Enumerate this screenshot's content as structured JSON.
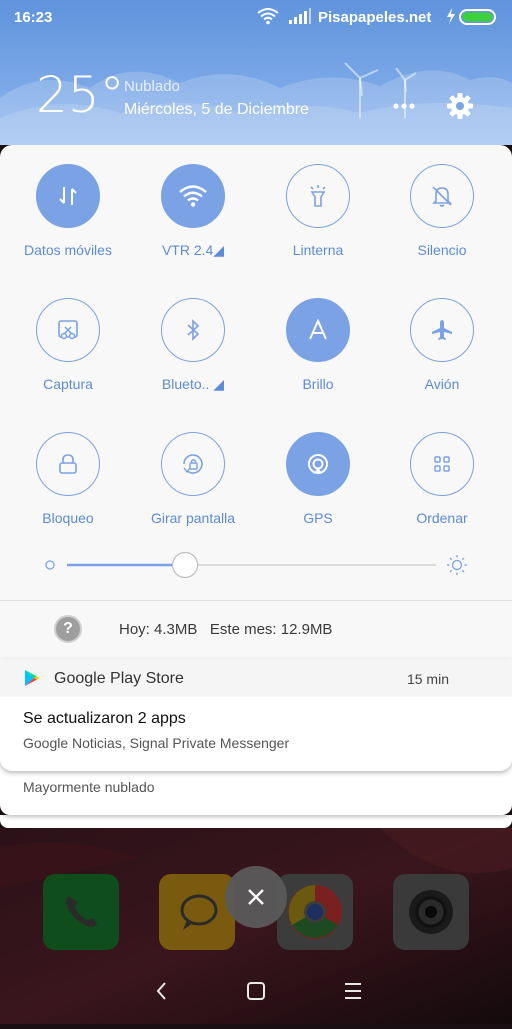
{
  "status_bar": {
    "time": "16:23",
    "carrier": "Pisapapeles.net",
    "icons": [
      "wifi-icon",
      "signal-icon",
      "charging-icon",
      "battery-icon"
    ],
    "battery_color": "#3cd03c"
  },
  "weather": {
    "temperature": "25°",
    "condition": "Nublado",
    "date": "Miércoles, 5 de Diciembre"
  },
  "quick_settings": {
    "accent_color": "#7ba2e5",
    "tiles": [
      {
        "label": "Datos móviles",
        "icon": "mobile-data-icon",
        "active": true
      },
      {
        "label": "VTR 2.4◢",
        "icon": "wifi-icon",
        "active": true
      },
      {
        "label": "Linterna",
        "icon": "flashlight-icon",
        "active": false
      },
      {
        "label": "Silencio",
        "icon": "bell-off-icon",
        "active": false
      },
      {
        "label": "Captura",
        "icon": "screenshot-icon",
        "active": false
      },
      {
        "label": "Blueto.. ◢",
        "icon": "bluetooth-icon",
        "active": false
      },
      {
        "label": "Brillo",
        "icon": "auto-brightness-icon",
        "active": true
      },
      {
        "label": "Avión",
        "icon": "airplane-icon",
        "active": false
      },
      {
        "label": "Bloqueo",
        "icon": "lock-icon",
        "active": false
      },
      {
        "label": "Girar pantalla",
        "icon": "rotate-lock-icon",
        "active": false
      },
      {
        "label": "GPS",
        "icon": "gps-icon",
        "active": true
      },
      {
        "label": "Ordenar",
        "icon": "grid-icon",
        "active": false
      }
    ]
  },
  "brightness": {
    "level": 0.32
  },
  "data_usage": {
    "today": "Hoy: 4.3MB",
    "month": "Este mes: 12.9MB"
  },
  "notifications": [
    {
      "app": "Google Play Store",
      "time": "15 min",
      "title": "Se actualizaron 2 apps",
      "body": "Google Noticias, Signal Private Messenger"
    },
    {
      "body": "Mayormente nublado"
    }
  ],
  "dock_apps": [
    "phone-app-icon",
    "messages-app-icon",
    "chrome-app-icon",
    "camera-app-icon"
  ],
  "navbar": [
    "back-button",
    "home-button",
    "menu-button"
  ]
}
